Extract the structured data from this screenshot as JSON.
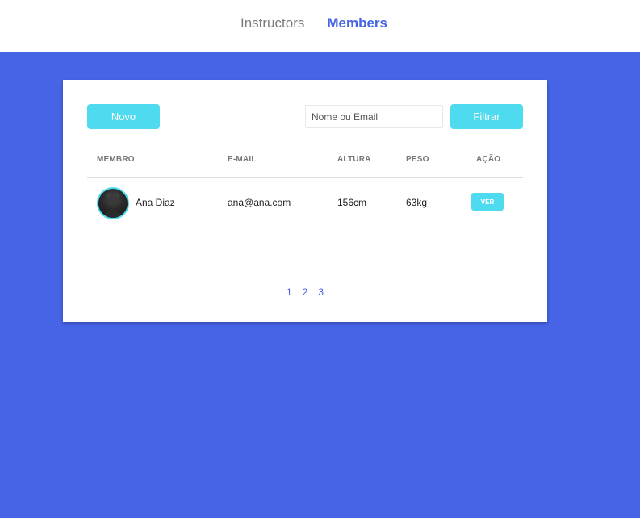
{
  "nav": {
    "items": [
      {
        "label": "Instructors",
        "active": false
      },
      {
        "label": "Members",
        "active": true
      }
    ]
  },
  "toolbar": {
    "new_label": "Novo",
    "search_placeholder": "Nome ou Email",
    "search_value": "",
    "filter_label": "Filtrar"
  },
  "table": {
    "headers": [
      "MEMBRO",
      "E-MAIL",
      "ALTURA",
      "PESO",
      "AÇÃO"
    ],
    "rows": [
      {
        "avatar": "user-avatar",
        "name": "Ana Diaz",
        "email": "ana@ana.com",
        "height": "156cm",
        "weight": "63kg",
        "action": "VER"
      }
    ]
  },
  "pagination": {
    "pages": [
      "1",
      "2",
      "3"
    ]
  },
  "colors": {
    "background": "#4764e6",
    "accent": "#4fdbef",
    "active_nav": "#4764e6"
  }
}
